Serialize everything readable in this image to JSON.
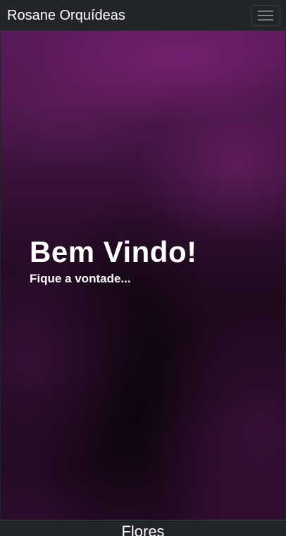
{
  "navbar": {
    "brand": "Rosane Orquídeas",
    "toggler_icon": "hamburger-menu-icon"
  },
  "hero": {
    "title": "Bem Vindo!",
    "subtitle": "Fique a vontade..."
  },
  "section": {
    "title": "Flores"
  },
  "colors": {
    "navbar_bg": "#212529",
    "hero_primary": "#5a1a5c",
    "text": "#ffffff"
  }
}
